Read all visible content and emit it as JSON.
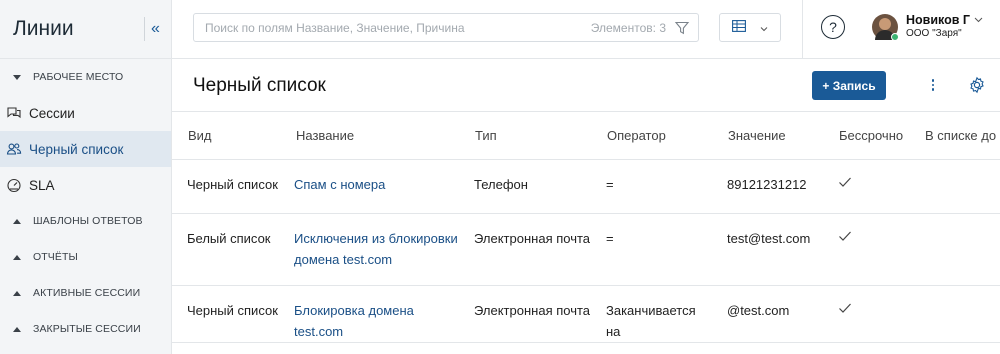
{
  "sidebar": {
    "title": "Линии",
    "sections": [
      {
        "label": "РАБОЧЕЕ МЕСТО",
        "expanded": true
      },
      {
        "label": "ШАБЛОНЫ ОТВЕТОВ",
        "expanded": false
      },
      {
        "label": "ОТЧЁТЫ",
        "expanded": false
      },
      {
        "label": "АКТИВНЫЕ СЕССИИ",
        "expanded": false
      },
      {
        "label": "ЗАКРЫТЫЕ СЕССИИ",
        "expanded": false
      }
    ],
    "items": [
      {
        "label": "Сессии",
        "icon": "chat-bubbles-icon"
      },
      {
        "label": "Черный список",
        "icon": "users-icon",
        "active": true
      },
      {
        "label": "SLA",
        "icon": "speedometer-icon"
      }
    ]
  },
  "search": {
    "placeholder": "Поиск по полям Название, Значение, Причина",
    "count": "Элементов: 3"
  },
  "user": {
    "name": "Новиков Г",
    "org": "ООО \"Заря\""
  },
  "page": {
    "title": "Черный список",
    "add_label": "+ Запись"
  },
  "table": {
    "columns": [
      "Вид",
      "Название",
      "Тип",
      "Оператор",
      "Значение",
      "Бессрочно",
      "В списке до"
    ],
    "rows": [
      {
        "kind": "Черный список",
        "name": "Спам с номера",
        "type": "Телефон",
        "operator": "=",
        "value": "89121231212",
        "permanent": true,
        "until": ""
      },
      {
        "kind": "Белый список",
        "name": "Исключения из блокировки домена test.com",
        "type": "Электронная почта",
        "operator": "=",
        "value": "test@test.com",
        "permanent": true,
        "until": ""
      },
      {
        "kind": "Черный список",
        "name": "Блокировка домена test.com",
        "type": "Электронная почта",
        "operator": "Заканчивается на",
        "value": "@test.com",
        "permanent": true,
        "until": ""
      }
    ]
  },
  "colors": {
    "accent": "#1a5a97",
    "sidebar_bg": "#f3f5f7",
    "active_item_bg": "#e0e8f0",
    "link": "#1a4f86"
  }
}
